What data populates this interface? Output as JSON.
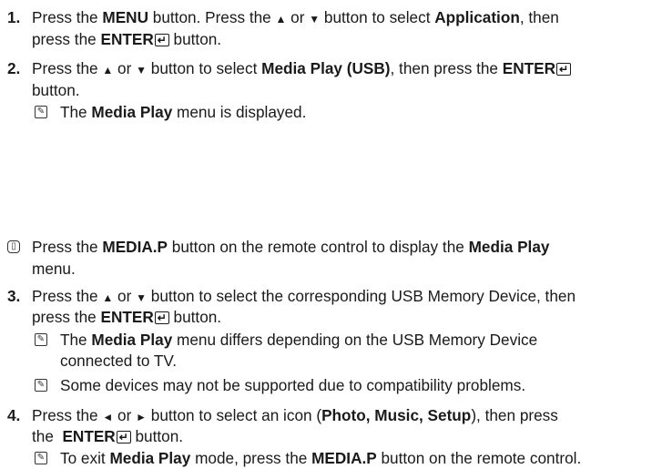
{
  "step1": {
    "num": "1.",
    "l1a": "Press the ",
    "l1b": "MENU",
    "l1c": " button. Press the ",
    "l1d": "▲",
    "l1e": " or ",
    "l1f": "▼",
    "l1g": " button to select ",
    "l1h": "Application",
    "l1i": ", then",
    "l2a": "press the ",
    "l2b": "ENTER",
    "l2c": " button."
  },
  "step2": {
    "num": "2.",
    "l1a": "Press the ",
    "l1b": "▲",
    "l1c": " or ",
    "l1d": "▼",
    "l1e": " button to select ",
    "l1f": "Media Play (USB)",
    "l1g": ", then press the ",
    "l1h": "ENTER",
    "l2": "button.",
    "note_a": "The ",
    "note_b": "Media Play",
    "note_c": " menu is displayed."
  },
  "tip": {
    "l1a": "Press the ",
    "l1b": "MEDIA.P",
    "l1c": " button on the remote control to display the ",
    "l1d": "Media Play",
    "l2": "menu."
  },
  "step3": {
    "num": "3.",
    "l1a": "Press the ",
    "l1b": "▲",
    "l1c": " or ",
    "l1d": "▼",
    "l1e": " button to select the corresponding USB Memory Device, then",
    "l2a": "press the ",
    "l2b": "ENTER",
    "l2c": " button.",
    "n1a": "The ",
    "n1b": "Media Play",
    "n1c": " menu differs depending on the USB Memory Device",
    "n1l2": "connected to TV.",
    "n2": "Some devices may not be supported due to compatibility problems."
  },
  "step4": {
    "num": "4.",
    "l1a": "Press the ",
    "l1b": "◄",
    "l1c": " or ",
    "l1d": "►",
    "l1e": " button to select an icon (",
    "l1f": "Photo, Music, Setup",
    "l1g": "), then press",
    "l2a": "the  ",
    "l2b": "ENTER",
    "l2c": " button.",
    "na": "To exit ",
    "nb": "Media Play",
    "nc": " mode, press the ",
    "nd": "MEDIA.P",
    "ne": " button on the remote control."
  }
}
